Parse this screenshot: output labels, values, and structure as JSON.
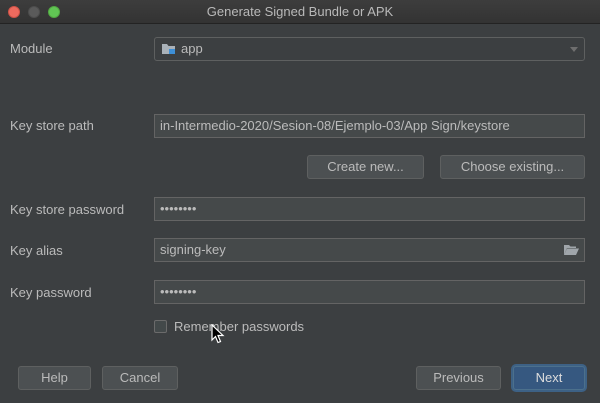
{
  "window": {
    "title": "Generate Signed Bundle or APK"
  },
  "form": {
    "module_label": "Module",
    "module_value": "app",
    "keystore_path_label": "Key store path",
    "keystore_path_value": "in-Intermedio-2020/Sesion-08/Ejemplo-03/App Sign/keystore",
    "create_new_label": "Create new...",
    "choose_existing_label": "Choose existing...",
    "keystore_password_label": "Key store password",
    "keystore_password_value": "••••••••",
    "key_alias_label": "Key alias",
    "key_alias_value": "signing-key",
    "key_password_label": "Key password",
    "key_password_value": "••••••••",
    "remember_label": "Remember passwords",
    "remember_checked": false
  },
  "footer": {
    "help_label": "Help",
    "cancel_label": "Cancel",
    "previous_label": "Previous",
    "next_label": "Next"
  },
  "icons": {
    "module": "folder-module-icon",
    "dropdown": "chevron-down-icon",
    "browse": "folder-open-icon",
    "cursor": "mouse-pointer-icon"
  },
  "colors": {
    "background": "#3c3f41",
    "field": "#45494a",
    "primary_button": "#365880",
    "text": "#bbbbbb"
  }
}
